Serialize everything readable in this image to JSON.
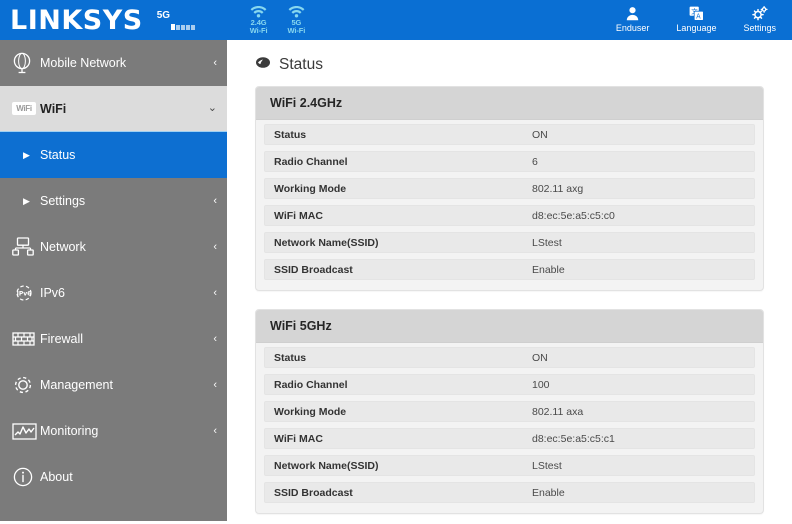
{
  "header": {
    "brand": "LINKSYS",
    "mobile": {
      "network_label": "5G",
      "signal_bars_total": 5,
      "signal_bars_active": 1
    },
    "wifi_indicators": [
      {
        "icon": "wifi-icon",
        "line1": "2.4G",
        "line2": "Wi-Fi"
      },
      {
        "icon": "wifi-icon",
        "line1": "5G",
        "line2": "Wi-Fi"
      }
    ],
    "actions": [
      {
        "icon": "user-icon",
        "label": "Enduser"
      },
      {
        "icon": "language-icon",
        "label": "Language"
      },
      {
        "icon": "gear-icon",
        "label": "Settings"
      }
    ],
    "colors": {
      "bar_blue": "#0a6fd3",
      "wifi_cyan": "#87d7ef"
    }
  },
  "sidebar": {
    "colors": {
      "background": "#7b7b7b",
      "active_blue": "#0d6fd1",
      "expanded_gray": "#dcdcdc"
    },
    "items": [
      {
        "icon": "globe-icon",
        "label": "Mobile Network",
        "chevron": "‹",
        "state": "collapsed"
      },
      {
        "icon": "wifi-badge-icon",
        "label": "WiFi",
        "chevron": "⌄",
        "state": "expanded"
      },
      {
        "icon": "network-icon",
        "label": "Network",
        "chevron": "‹",
        "state": "collapsed"
      },
      {
        "icon": "ipv6-icon",
        "label": "IPv6",
        "chevron": "‹",
        "state": "collapsed"
      },
      {
        "icon": "firewall-icon",
        "label": "Firewall",
        "chevron": "‹",
        "state": "collapsed"
      },
      {
        "icon": "gear-icon",
        "label": "Management",
        "chevron": "‹",
        "state": "collapsed"
      },
      {
        "icon": "chart-icon",
        "label": "Monitoring",
        "chevron": "‹",
        "state": "collapsed"
      },
      {
        "icon": "info-icon",
        "label": "About",
        "chevron": "",
        "state": "collapsed"
      }
    ],
    "wifi_subitems": [
      {
        "bullet": "▶",
        "label": "Status",
        "chevron": "",
        "state": "active"
      },
      {
        "bullet": "▶",
        "label": "Settings",
        "chevron": "‹",
        "state": "normal"
      }
    ],
    "wifi_badge_text": "WiFi"
  },
  "main": {
    "title_icon": "leaf-icon",
    "title": "Status",
    "panels": [
      {
        "heading": "WiFi 2.4GHz",
        "rows": [
          {
            "label": "Status",
            "value": "ON"
          },
          {
            "label": "Radio Channel",
            "value": "6"
          },
          {
            "label": "Working Mode",
            "value": "802.11 axg"
          },
          {
            "label": "WiFi MAC",
            "value": "d8:ec:5e:a5:c5:c0"
          },
          {
            "label": "Network Name(SSID)",
            "value": "LStest"
          },
          {
            "label": "SSID Broadcast",
            "value": "Enable"
          }
        ]
      },
      {
        "heading": "WiFi 5GHz",
        "rows": [
          {
            "label": "Status",
            "value": "ON"
          },
          {
            "label": "Radio Channel",
            "value": "100"
          },
          {
            "label": "Working Mode",
            "value": "802.11 axa"
          },
          {
            "label": "WiFi MAC",
            "value": "d8:ec:5e:a5:c5:c1"
          },
          {
            "label": "Network Name(SSID)",
            "value": "LStest"
          },
          {
            "label": "SSID Broadcast",
            "value": "Enable"
          }
        ]
      }
    ]
  }
}
